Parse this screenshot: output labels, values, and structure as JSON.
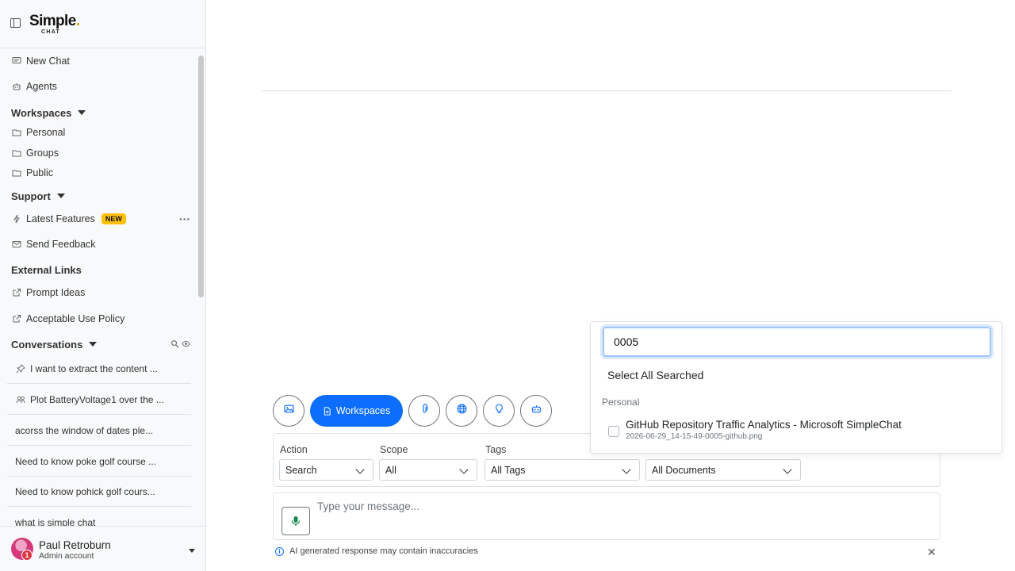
{
  "app": {
    "logo_main": "Simple",
    "logo_sub": "CHAT"
  },
  "sidebar": {
    "new_chat": "New Chat",
    "agents": "Agents",
    "workspaces_header": "Workspaces",
    "workspaces": [
      "Personal",
      "Groups",
      "Public"
    ],
    "support_header": "Support",
    "latest_features": "Latest Features",
    "new_badge": "NEW",
    "send_feedback": "Send Feedback",
    "external_header": "External Links",
    "prompt_ideas": "Prompt Ideas",
    "acceptable_use": "Acceptable Use Policy",
    "conversations_header": "Conversations",
    "conversations": [
      "I want to extract the content ...",
      "Plot BatteryVoltage1 over the ...",
      "acorss the window of dates ple...",
      "Need to know poke golf course ...",
      "Need to know pohick golf cours...",
      "what is simple chat"
    ]
  },
  "user": {
    "name": "Paul Retroburn",
    "role": "Admin account",
    "notifications": "1"
  },
  "toolbar": {
    "workspaces_label": "Workspaces"
  },
  "filters": {
    "action_label": "Action",
    "action_value": "Search",
    "scope_label": "Scope",
    "scope_value": "All",
    "tags_label": "Tags",
    "tags_value": "All Tags",
    "documents_value": "All Documents"
  },
  "message": {
    "placeholder": "Type your message..."
  },
  "disclaimer": "AI generated response may contain inaccuracies",
  "dropdown": {
    "search_value": "0005",
    "select_all": "Select All Searched",
    "group_label": "Personal",
    "item_title": "GitHub Repository Traffic Analytics - Microsoft SimpleChat",
    "item_file": "2026-06-29_14-15-49-0005-github.png"
  },
  "colors": {
    "primary": "#0d6efd",
    "new_badge": "#ffc107",
    "notification": "#dc3545",
    "mic": "#198754"
  }
}
